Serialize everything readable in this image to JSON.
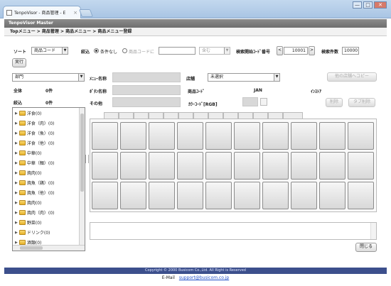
{
  "browser": {
    "tab_title": "TenpoVisor - 商品管理 - E",
    "tab_close": "×",
    "btn_min": "—",
    "btn_max": "□",
    "btn_close": "✕"
  },
  "app": {
    "title": "TenpoVisor Master",
    "breadcrumb": "Topメニュー > 商品管理 > 商品メニュー > 商品メニュー登録"
  },
  "toolbar": {
    "sort_label": "ソート",
    "sort_value": "商品コード",
    "narrow_label": "絞込",
    "radio_none": "条件なし",
    "radio_code": "商品コードに",
    "match_value": "含む",
    "start_code_label": "検索開始ｺｰﾄﾞ番号",
    "start_code_value": "10001",
    "prev_label": "<",
    "next_label": ">",
    "count_label": "検索件数",
    "count_value": "10000",
    "run_button": "実行"
  },
  "left": {
    "category_select": "部門",
    "total_label": "全体",
    "total_value": "0件",
    "filtered_label": "絞込",
    "filtered_value": "0件",
    "tree_items": [
      "洋食(0)",
      "洋食（肉）(0)",
      "洋食（魚）(0)",
      "洋食（他）(0)",
      "中華(0)",
      "中華（麺）(0)",
      "焼肉(0)",
      "焼魚（鶏）(0)",
      "焼魚（他）(0)",
      "焼肉(0)",
      "焼肉（肉）(0)",
      "野菜(0)",
      "ドリンク(0)",
      "酒類(0)"
    ]
  },
  "form": {
    "menu_name_label": "ﾒﾆｭｰ名称",
    "store_label": "店舗",
    "store_value": "未選択",
    "copy_button": "他の店舗へコピー",
    "button_name_label": "ﾎﾞﾀﾝ名称",
    "product_code_label": "商品ｺｰﾄﾞ",
    "jan_label": "JAN",
    "instore_label": "ｲﾝｽﾄｱ",
    "other_label": "その他",
    "color_code_label": "ｶﾗｰｺｰﾄﾞ[RGB]",
    "delete_button": "削除",
    "tab_delete_button": "タブ削除"
  },
  "bottom": {
    "close_button": "閉じる",
    "copyright": "Copyright © 2000 Busicom Co.,Ltd. All Right is Reserved",
    "email_label": "E-Mail",
    "email": "support@busicom.co.jp"
  },
  "colors": {
    "footer": "#3c4f8c",
    "appbar": "#7a7a7a",
    "chrome": "#b5cde8"
  }
}
